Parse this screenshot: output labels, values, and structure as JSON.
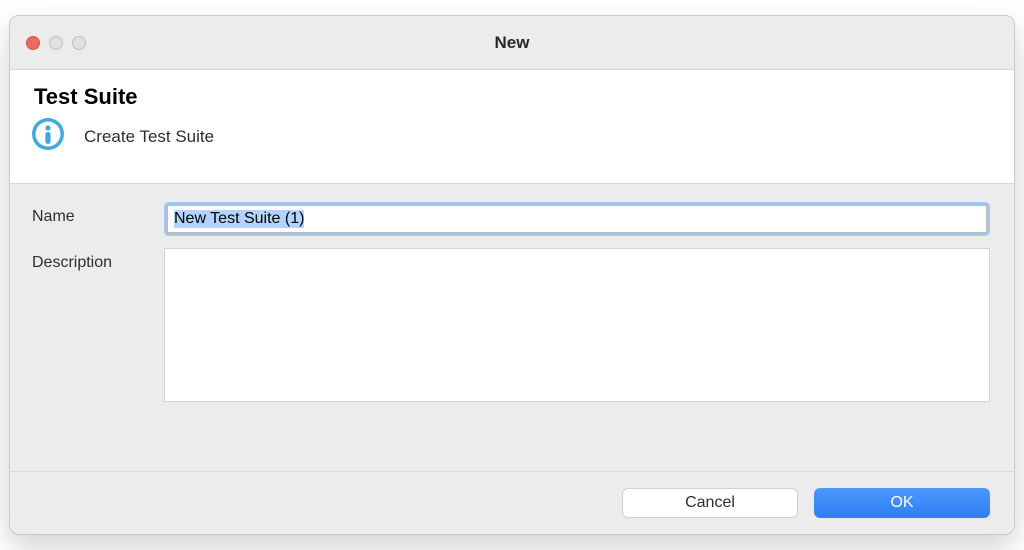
{
  "window": {
    "title": "New"
  },
  "header": {
    "heading": "Test Suite",
    "description": "Create Test Suite",
    "icon": "info-icon"
  },
  "form": {
    "name_label": "Name",
    "name_value": "New Test Suite (1)",
    "description_label": "Description",
    "description_value": ""
  },
  "footer": {
    "cancel_label": "Cancel",
    "ok_label": "OK"
  }
}
